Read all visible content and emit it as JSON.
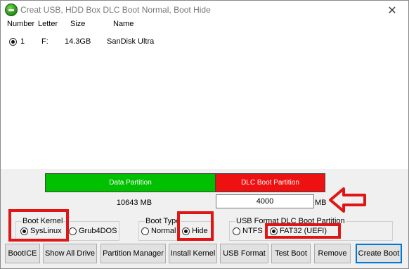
{
  "window": {
    "title": "Creat USB, HDD Box DLC Boot Normal, Boot Hide",
    "close_glyph": "✕"
  },
  "drive_list": {
    "headers": [
      "Number",
      "Letter",
      "Size",
      "Name"
    ],
    "rows": [
      {
        "number": "1",
        "letter": "F:",
        "size": "14.3GB",
        "name": "SanDisk Ultra",
        "selected": true
      }
    ]
  },
  "partitions": {
    "data_label": "Data Partition",
    "dlc_label": "DLC Boot Partition",
    "data_size": "10643 MB",
    "dlc_size_value": "4000",
    "dlc_size_unit": "MB",
    "data_color": "#00c000",
    "dlc_color": "#ee1111"
  },
  "boot_kernel": {
    "label": "Boot Kernel",
    "options": [
      {
        "label": "SysLinux",
        "selected": true
      },
      {
        "label": "Grub4DOS",
        "selected": false
      }
    ]
  },
  "boot_type": {
    "label": "Boot Type",
    "options": [
      {
        "label": "Normal",
        "selected": false
      },
      {
        "label": "Hide",
        "selected": true
      }
    ]
  },
  "usb_format": {
    "label": "USB Format DLC Boot Partition",
    "options": [
      {
        "label": "NTFS",
        "selected": false
      },
      {
        "label": "FAT32 (UEFI)",
        "selected": true
      }
    ]
  },
  "buttons": {
    "bootice": "BootICE",
    "show_all_drive": "Show All Drive",
    "partition_manager": "Partition Manager",
    "install_kernel": "Install Kernel",
    "usb_format": "USB Format",
    "test_boot": "Test Boot",
    "remove": "Remove",
    "create_boot": "Create Boot"
  },
  "annotation_color": "#e01515"
}
